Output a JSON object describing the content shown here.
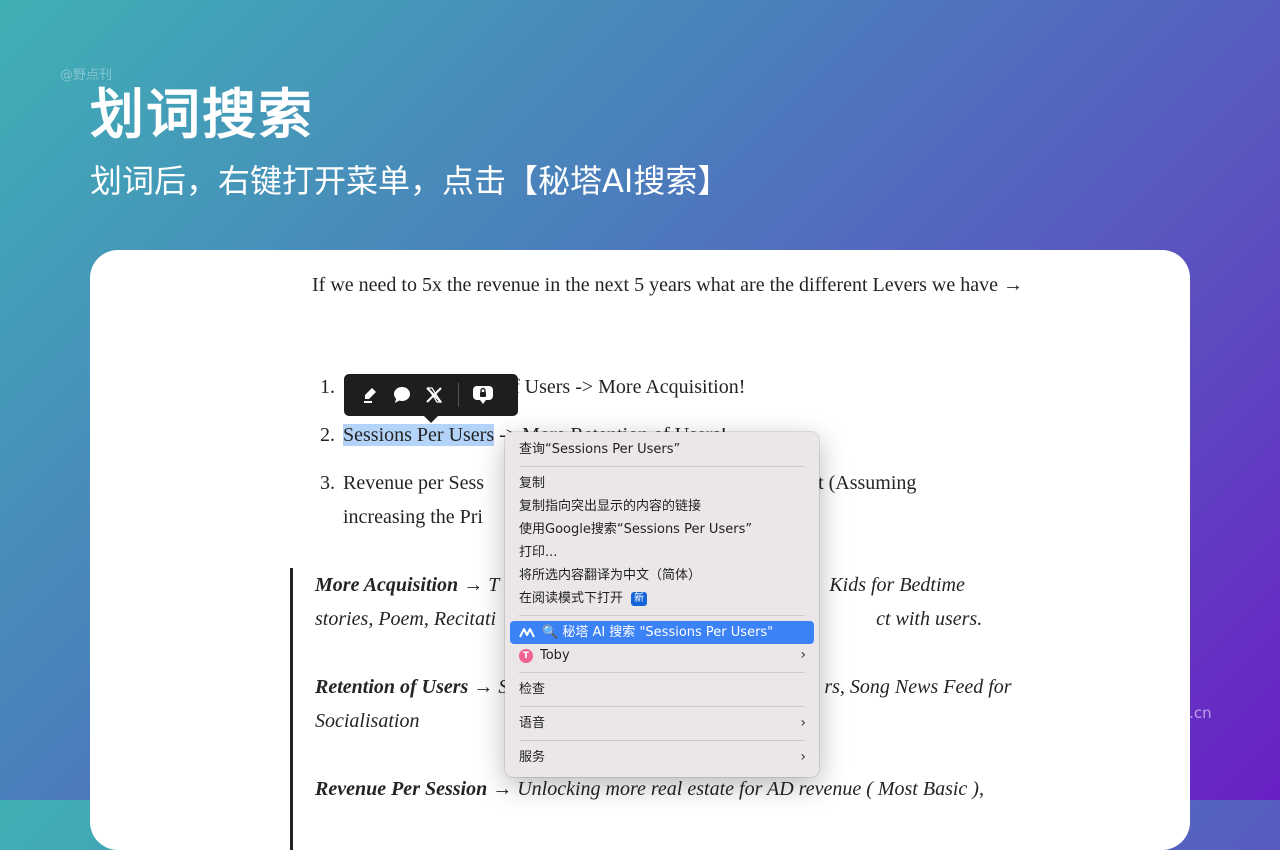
{
  "watermark_top": "@野点刊",
  "hero": {
    "title": "划词搜索",
    "subtitle": "划词后，右键打开菜单，点击【秘塔AI搜索】"
  },
  "article": {
    "intro": "If we need to 5x the revenue in the next 5 years what are the different Levers we have →",
    "list": [
      {
        "num": "1.",
        "text": "f Users -> More Acquisition!"
      },
      {
        "num": "2.",
        "highlight": "Sessions Per Users",
        "rest": " -> More Retention of Users!"
      },
      {
        "num": "3.",
        "line1": "Revenue per Sess",
        "line1b": "nt (Assuming",
        "line2": "increasing the Pri"
      }
    ],
    "quotes": [
      {
        "bold": "More Acquisition",
        "rest": " → T",
        "right": "Kids for Bedtime",
        "line2": "stories, Poem, Recitati",
        "line2b": "ct with users."
      },
      {
        "bold": "Retention of Users",
        "rest": " → S",
        "right": "rs, Song News Feed for",
        "line2": "Socialisation"
      },
      {
        "bold": "Revenue Per Session",
        "rest": " → Unlocking more real estate for AD revenue ( Most Basic ),"
      }
    ]
  },
  "toolbar": {
    "icons": [
      "highlight-pen-icon",
      "comment-icon",
      "x-share-icon",
      "private-note-icon"
    ]
  },
  "context_menu": {
    "lookup": "查询“Sessions Per Users”",
    "copy": "复制",
    "copy_link": "复制指向突出显示的内容的链接",
    "google_search": "使用Google搜索“Sessions Per Users”",
    "print": "打印...",
    "translate": "将所选内容翻译为中文（简体）",
    "reader_mode": "在阅读模式下打开",
    "new_badge": "新",
    "metaso_search": "🔍 秘塔 AI 搜索 \"Sessions Per Users\"",
    "toby": "Toby",
    "inspect": "检查",
    "speech": "语音",
    "services": "服务",
    "arrow": "›"
  },
  "colors": {
    "selection": "#b3d3f8",
    "menu_active": "#3b82f6",
    "metaso_logo": "#3b5bdb"
  },
  "watermark_bottom": "chrome.zzzmh.cn"
}
